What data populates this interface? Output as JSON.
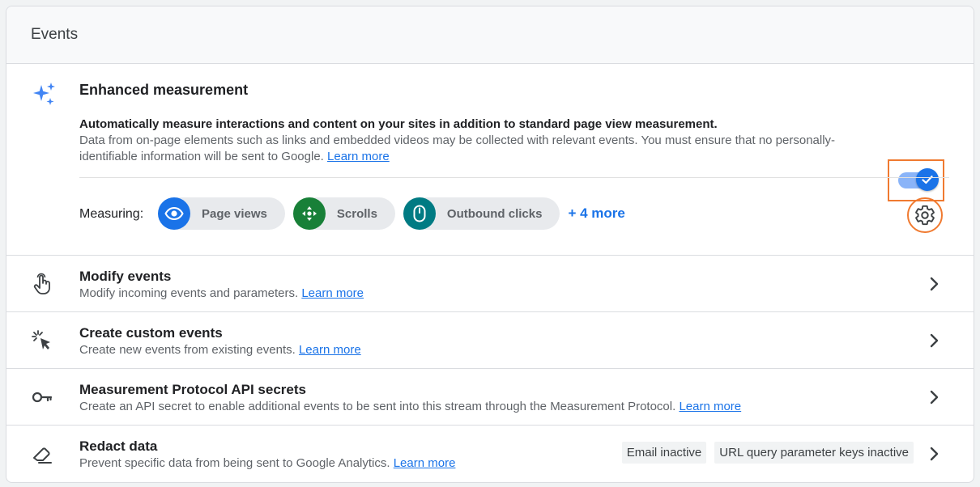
{
  "header": {
    "title": "Events"
  },
  "enhanced": {
    "title": "Enhanced measurement",
    "desc_bold": "Automatically measure interactions and content on your sites in addition to standard page view measurement.",
    "desc": "Data from on-page elements such as links and embedded videos may be collected with relevant events. You must ensure that no personally-identifiable information will be sent to Google.",
    "learn_more": "Learn more",
    "toggle_on": true,
    "measuring_label": "Measuring:",
    "chips": [
      {
        "label": "Page views",
        "icon": "eye-icon",
        "color": "#1a73e8"
      },
      {
        "label": "Scrolls",
        "icon": "scroll-arrows-icon",
        "color": "#188038"
      },
      {
        "label": "Outbound clicks",
        "icon": "mouse-icon",
        "color": "#007b83"
      }
    ],
    "more": "+ 4 more"
  },
  "rows": [
    {
      "title": "Modify events",
      "desc": "Modify incoming events and parameters.",
      "link": "Learn more",
      "icon": "touch-hand-icon"
    },
    {
      "title": "Create custom events",
      "desc": "Create new events from existing events.",
      "link": "Learn more",
      "icon": "cursor-click-icon"
    },
    {
      "title": "Measurement Protocol API secrets",
      "desc": "Create an API secret to enable additional events to be sent into this stream through the Measurement Protocol.",
      "link": "Learn more",
      "icon": "key-icon"
    },
    {
      "title": "Redact data",
      "desc": "Prevent specific data from being sent to Google Analytics.",
      "link": "Learn more",
      "icon": "eraser-icon",
      "badges": [
        "Email inactive",
        "URL query parameter keys inactive"
      ]
    }
  ],
  "colors": {
    "accent": "#1a73e8",
    "highlight": "#f07a30"
  }
}
